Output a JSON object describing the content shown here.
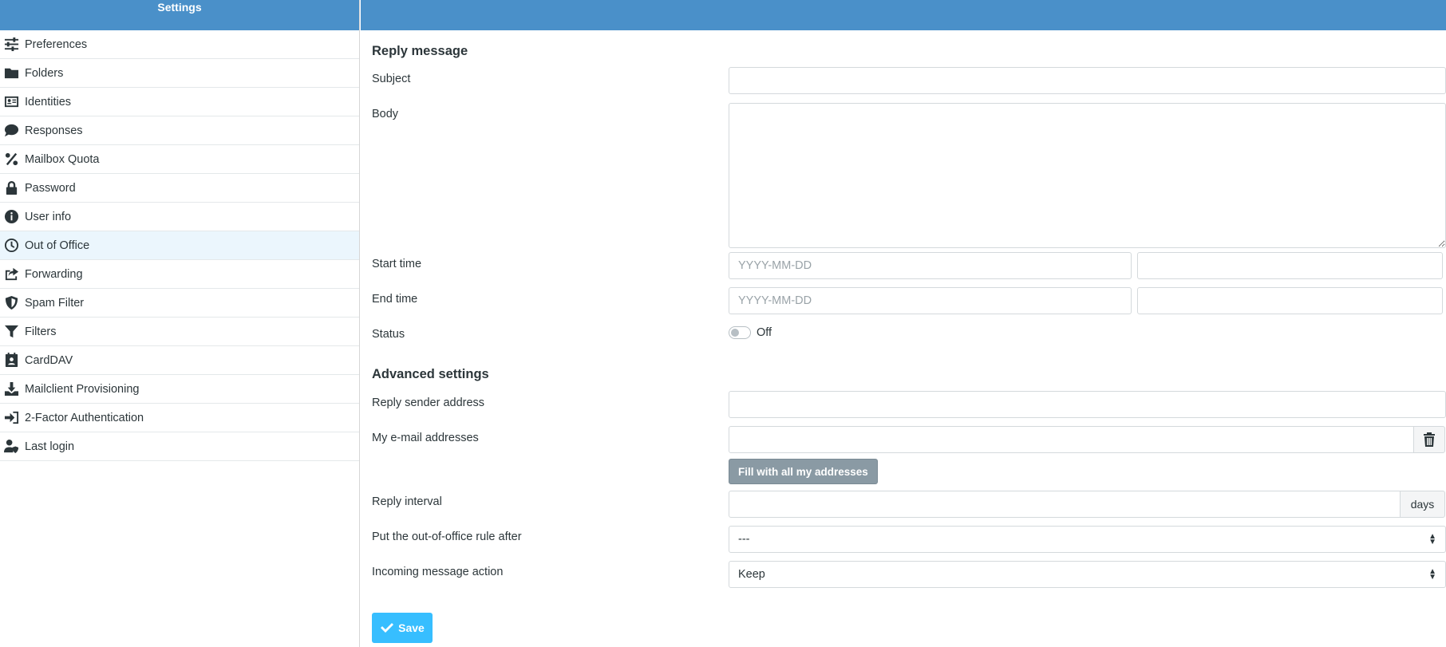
{
  "sidebar": {
    "title": "Settings",
    "items": [
      {
        "label": "Preferences",
        "icon": "sliders-icon"
      },
      {
        "label": "Folders",
        "icon": "folder-icon"
      },
      {
        "label": "Identities",
        "icon": "id-card-icon"
      },
      {
        "label": "Responses",
        "icon": "comment-icon"
      },
      {
        "label": "Mailbox Quota",
        "icon": "percent-icon"
      },
      {
        "label": "Password",
        "icon": "lock-icon"
      },
      {
        "label": "User info",
        "icon": "info-circle-icon"
      },
      {
        "label": "Out of Office",
        "icon": "clock-icon",
        "active": true
      },
      {
        "label": "Forwarding",
        "icon": "share-icon"
      },
      {
        "label": "Spam Filter",
        "icon": "shield-icon"
      },
      {
        "label": "Filters",
        "icon": "filter-icon"
      },
      {
        "label": "CardDAV",
        "icon": "address-book-icon"
      },
      {
        "label": "Mailclient Provisioning",
        "icon": "download-icon"
      },
      {
        "label": "2-Factor Authentication",
        "icon": "sign-in-icon"
      },
      {
        "label": "Last login",
        "icon": "user-shield-icon"
      }
    ]
  },
  "reply": {
    "section_title": "Reply message",
    "subject_label": "Subject",
    "subject_value": "",
    "body_label": "Body",
    "body_value": "",
    "start_label": "Start time",
    "start_date_placeholder": "YYYY-MM-DD",
    "start_time_value": "",
    "end_label": "End time",
    "end_date_placeholder": "YYYY-MM-DD",
    "end_time_value": "",
    "status_label": "Status",
    "status_value": "Off"
  },
  "advanced": {
    "section_title": "Advanced settings",
    "sender_label": "Reply sender address",
    "sender_value": "",
    "addresses_label": "My e-mail addresses",
    "addresses_value": "",
    "fill_button": "Fill with all my addresses",
    "interval_label": "Reply interval",
    "interval_value": "",
    "interval_unit": "days",
    "rule_after_label": "Put the out-of-office rule after",
    "rule_after_value": "---",
    "action_label": "Incoming message action",
    "action_value": "Keep"
  },
  "save_button": "Save",
  "colors": {
    "header": "#4a90c9",
    "active_item": "#ebf6fd",
    "save": "#37beff",
    "fill_button": "#8a9aa4"
  }
}
